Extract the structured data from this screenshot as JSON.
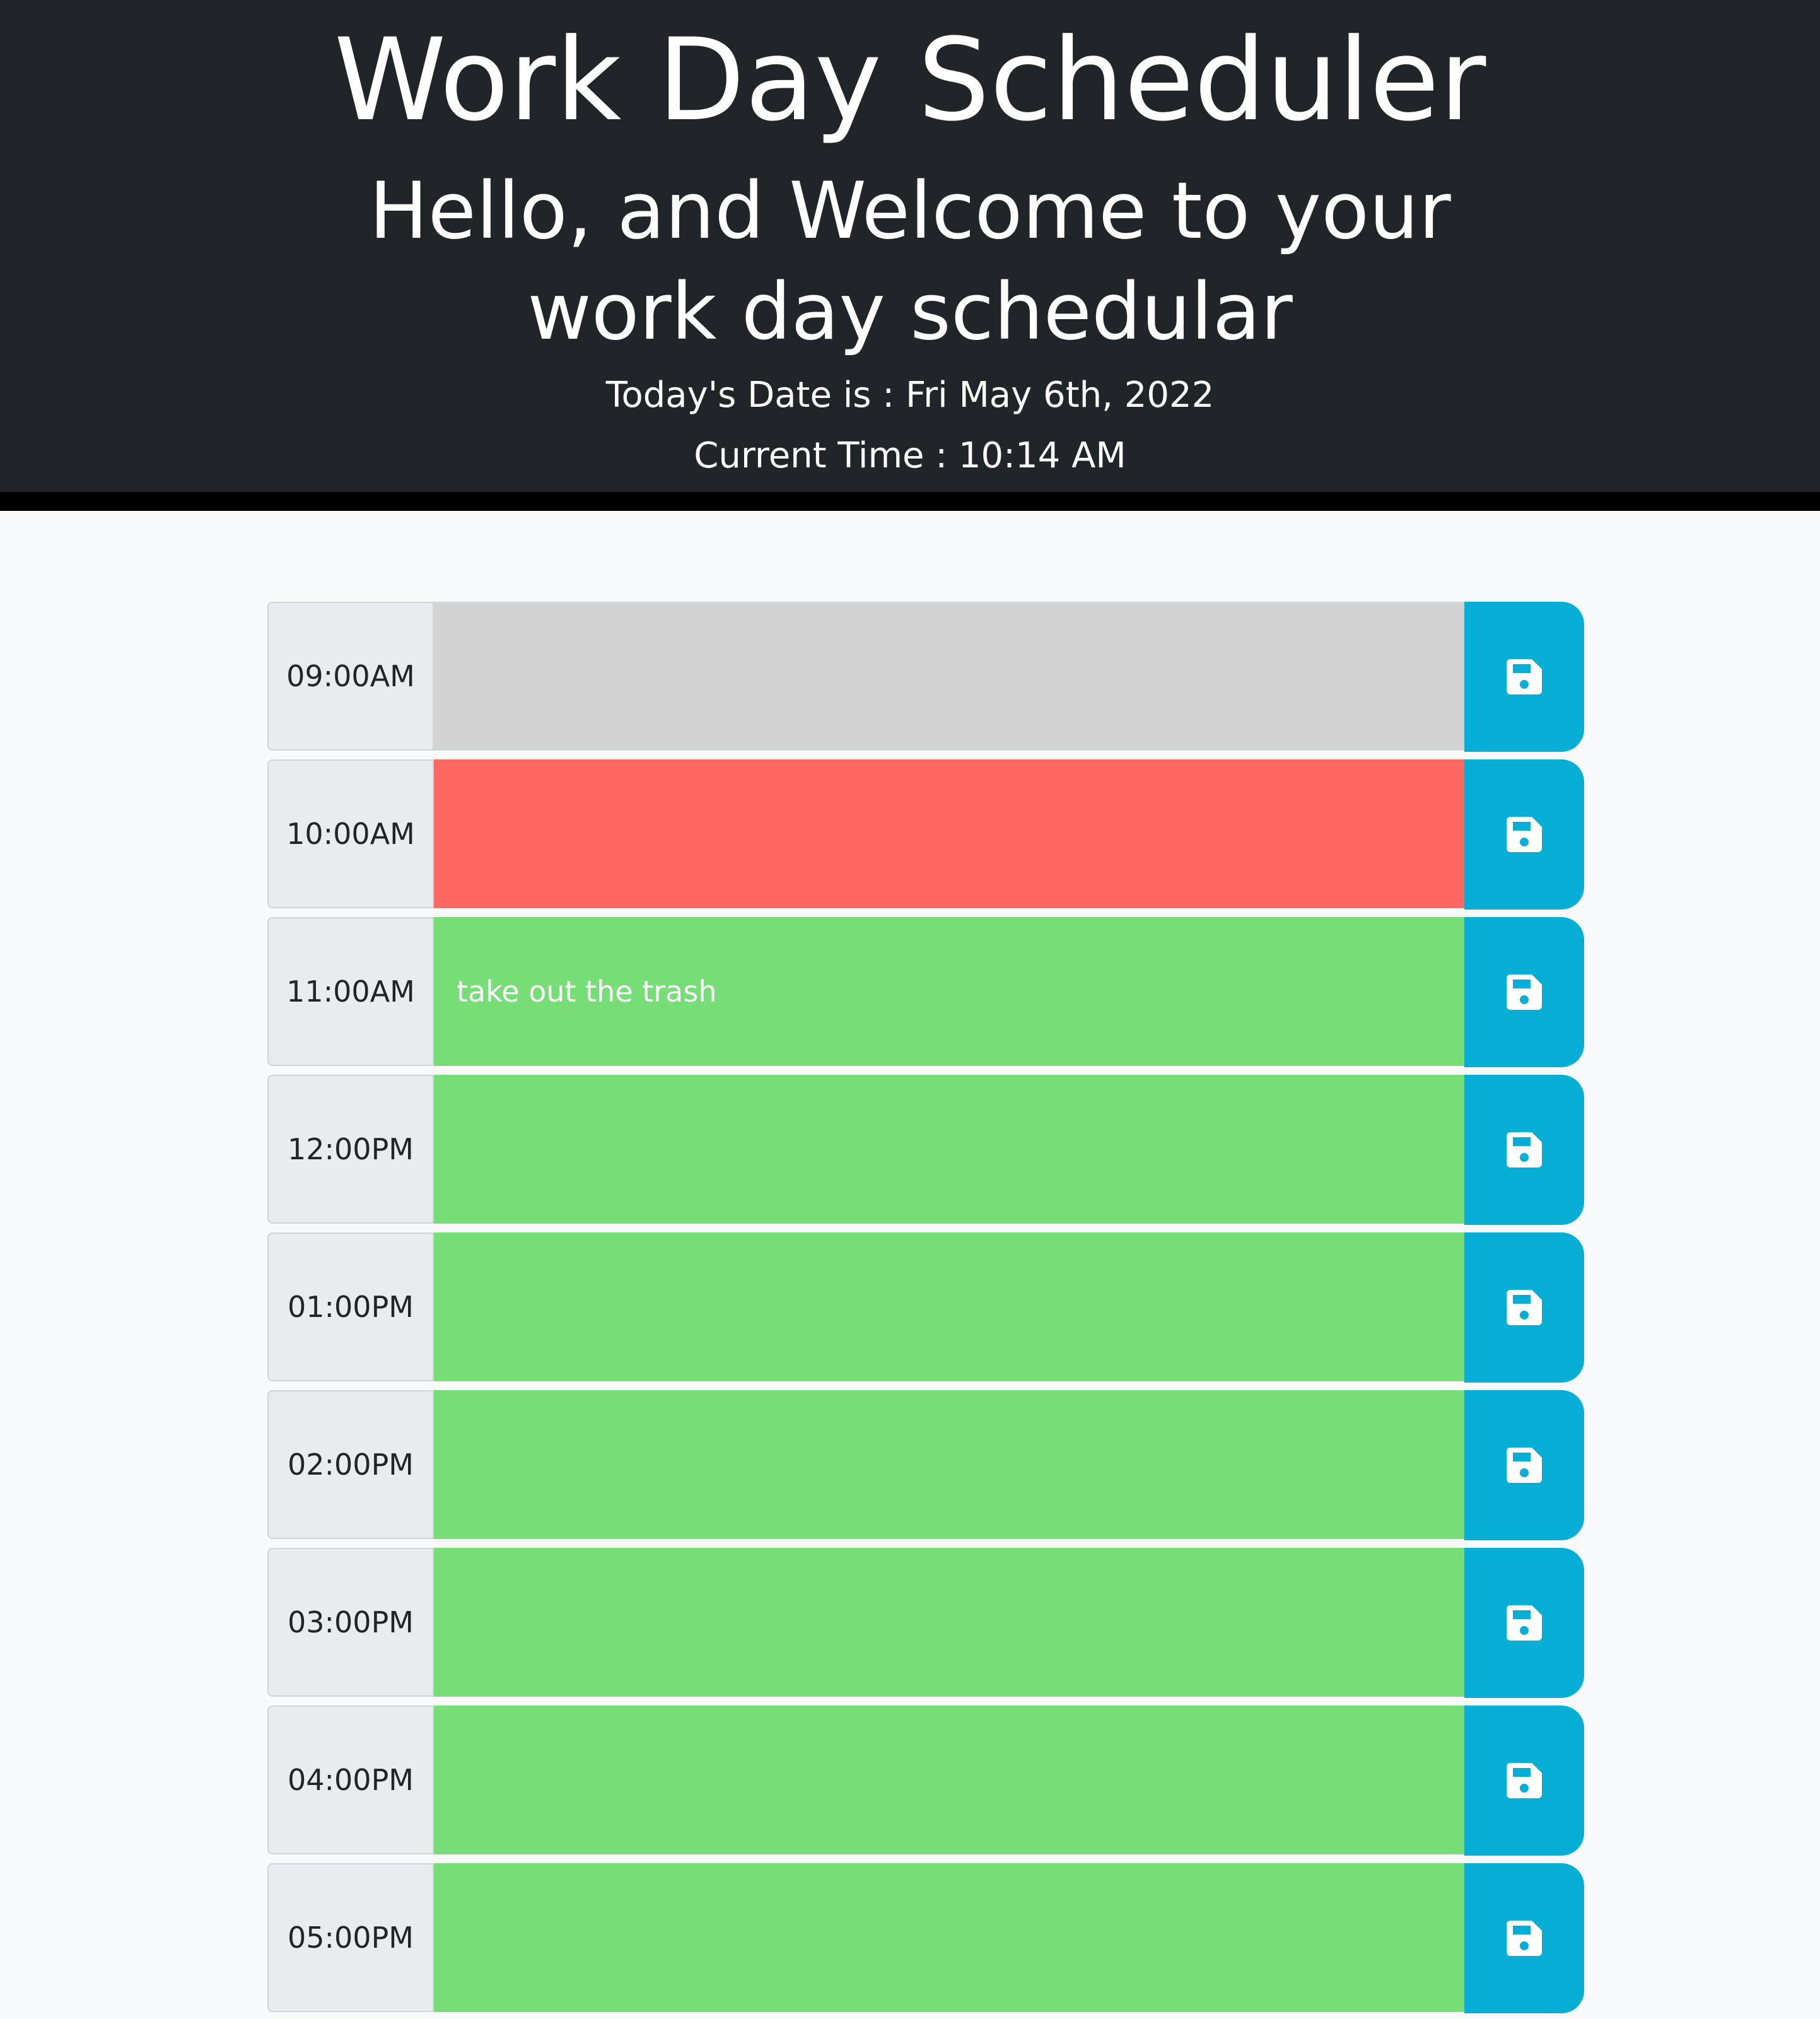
{
  "header": {
    "title": "Work Day Scheduler",
    "welcome": "Hello, and Welcome to your work day schedular",
    "date_text": "Today's Date is : Fri May 6th, 2022",
    "time_text": "Current Time : 10:14 AM"
  },
  "colors": {
    "header_bg": "#212529",
    "past": "#d3d3d3",
    "present": "#ff6961",
    "future": "#77dd77",
    "save_button": "#06aed5"
  },
  "save_icon": "floppy-disk-icon",
  "rows": [
    {
      "hour": "09:00AM",
      "state": "past",
      "text": ""
    },
    {
      "hour": "10:00AM",
      "state": "present",
      "text": ""
    },
    {
      "hour": "11:00AM",
      "state": "future",
      "text": "take out the trash"
    },
    {
      "hour": "12:00PM",
      "state": "future",
      "text": ""
    },
    {
      "hour": "01:00PM",
      "state": "future",
      "text": ""
    },
    {
      "hour": "02:00PM",
      "state": "future",
      "text": ""
    },
    {
      "hour": "03:00PM",
      "state": "future",
      "text": ""
    },
    {
      "hour": "04:00PM",
      "state": "future",
      "text": ""
    },
    {
      "hour": "05:00PM",
      "state": "future",
      "text": ""
    }
  ]
}
